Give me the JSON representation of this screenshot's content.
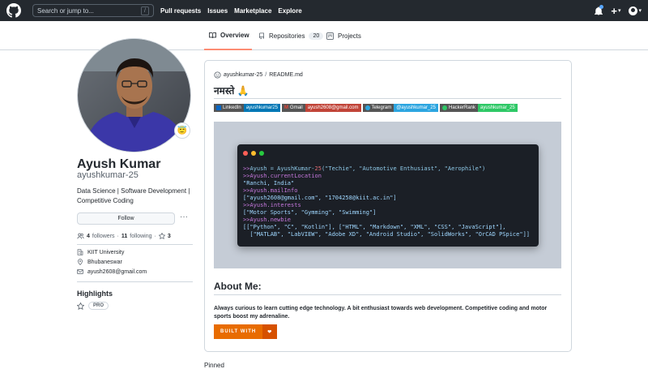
{
  "header": {
    "search_placeholder": "Search or jump to...",
    "slash": "/",
    "nav": [
      "Pull requests",
      "Issues",
      "Marketplace",
      "Explore"
    ],
    "plus": "+",
    "caret": "▾"
  },
  "tabs": {
    "overview": "Overview",
    "repositories": "Repositories",
    "repositories_count": "20",
    "projects": "Projects"
  },
  "profile": {
    "name": "Ayush Kumar",
    "username": "ayushkumar-25",
    "bio": "Data Science | Software Development | Competitive Coding",
    "follow": "Follow",
    "more": "···",
    "followers_count": "4",
    "followers_label": "followers",
    "dot_sep": "·",
    "following_count": "11",
    "following_label": "following",
    "stars_sep": "·",
    "stars": "3",
    "organization": "KIIT University",
    "location": "Bhubaneswar",
    "email": "ayush2608@gmail.com",
    "status_emoji": "😇",
    "highlights_title": "Highlights",
    "pro_badge": "PRO"
  },
  "readme": {
    "path_user": "ayushkumar-25",
    "path_sep": "/",
    "path_file": "README.md",
    "greeting": "नमस्ते 🙏",
    "badges": [
      {
        "label": "LinkedIn",
        "value": "ayushkumar25",
        "color": "#0077b5"
      },
      {
        "label": "Gmail",
        "value": "ayush2608@gmail.com",
        "color": "#c14438"
      },
      {
        "label": "Telegram",
        "value": "@ayushkumar_25",
        "color": "#2ca5e0"
      },
      {
        "label": "HackerRank",
        "value": "ayushkumar_25",
        "color": "#2ec866"
      }
    ],
    "about_title": "About Me:",
    "about_desc": "Always curious to learn cutting edge technology. A bit enthusiast towards web development. Competitive coding and motor sports boost my adrenaline.",
    "built_with": "BUILT WITH",
    "heart": "❤"
  },
  "terminal": {
    "line1_prompt": ">>",
    "line1_a": "Ayush = AyushKumar-",
    "line1_num": "25",
    "line1_b": "(\"Techie\", \"Automotive Enthusiast\", \"Aerophile\")",
    "line2_prompt": ">>",
    "line2": "Ayush.currentLocation",
    "line3": "\"Ranchi, India\"",
    "line4_prompt": ">>",
    "line4": "Ayush.mailInfo",
    "line5": "[\"ayush2608@gmail.com\", \"1704258@kiit.ac.in\"]",
    "line6_prompt": ">>",
    "line6": "Ayush.interests",
    "line7": "[\"Motor Sports\", \"Gymming\", \"Swimming\"]",
    "line8_prompt": ">>",
    "line8": "Ayush.newbie",
    "line9": "[[\"Python\", \"C\", \"Kotlin\"], [\"HTML\", \"Markdown\", \"XML\", \"CSS\", \"JavaScript\"],",
    "line10": "  [\"MATLAB\", \"LabVIEW\", \"Adobe XD\", \"Android Studio\", \"SolidWorks\", \"OrCAD PSpice\"]]"
  },
  "pinned": "Pinned"
}
